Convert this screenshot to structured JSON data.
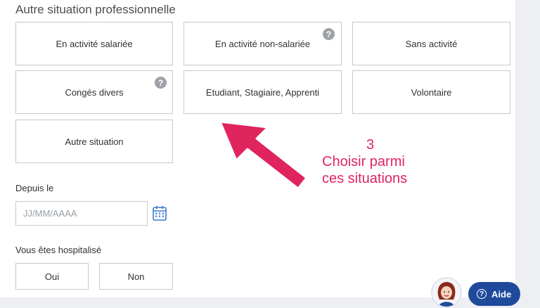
{
  "section": {
    "title": "Autre situation professionnelle"
  },
  "options": [
    {
      "label": "En activité salariée"
    },
    {
      "label": "En activité non-salariée",
      "help": "?"
    },
    {
      "label": "Sans activité"
    },
    {
      "label": "Congés divers",
      "help": "?"
    },
    {
      "label": "Etudiant, Stagiaire, Apprenti"
    },
    {
      "label": "Volontaire"
    },
    {
      "label": "Autre situation"
    }
  ],
  "depuis": {
    "label": "Depuis le",
    "placeholder": "JJ/MM/AAAA",
    "icon": "calendar-icon"
  },
  "hospitalise": {
    "label": "Vous êtes hospitalisé",
    "oui": "Oui",
    "non": "Non"
  },
  "annotation": {
    "number": "3",
    "line1": "Choisir parmi",
    "line2": "ces situations",
    "color": "#e0245e"
  },
  "help": {
    "label": "Aide",
    "icon": "?"
  },
  "colors": {
    "border": "#c6c8cc",
    "help_button": "#1f4a9c",
    "annotation": "#e0245e"
  }
}
